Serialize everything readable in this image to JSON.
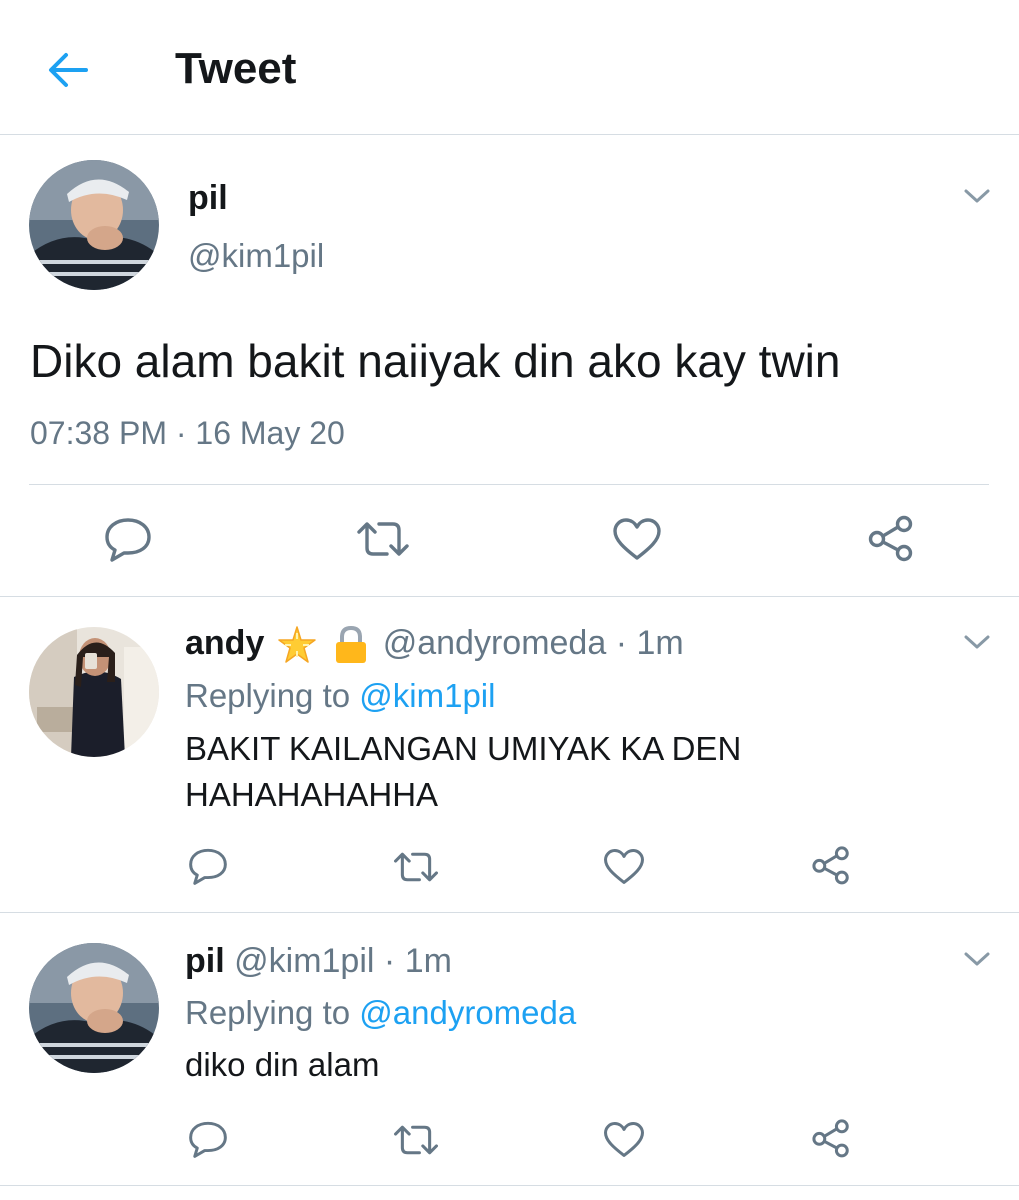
{
  "header": {
    "title": "Tweet",
    "back_icon": "arrow-left-icon",
    "accent": "#1da1f2"
  },
  "main_tweet": {
    "name": "pil",
    "handle": "@kim1pil",
    "text": "Diko alam bakit naiiyak din ako kay twin",
    "time": "07:38 PM",
    "sep": "·",
    "date": "16 May 20"
  },
  "replies": [
    {
      "name": "andy",
      "badges": [
        "star-emoji",
        "lock-emoji"
      ],
      "handle": "@andyromeda",
      "sep": "·",
      "age": "1m",
      "replying_prefix": "Replying to",
      "replying_to": "@kim1pil",
      "text_lines": [
        "BAKIT KAILANGAN UMIYAK KA DEN",
        "HAHAHAHAHHA"
      ]
    },
    {
      "name": "pil",
      "handle": "@kim1pil",
      "sep": "·",
      "age": "1m",
      "replying_prefix": "Replying to",
      "replying_to": "@andyromeda",
      "text_lines": [
        "diko din alam"
      ]
    }
  ],
  "actions": [
    "reply-icon",
    "retweet-icon",
    "like-icon",
    "share-icon"
  ],
  "colors": {
    "text": "#14171a",
    "muted": "#657786",
    "link": "#1da1f2",
    "divider": "#d6dde3"
  }
}
